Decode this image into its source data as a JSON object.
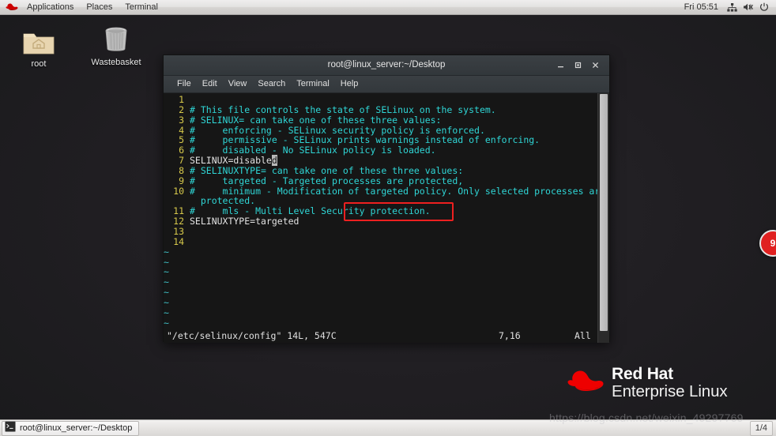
{
  "top_panel": {
    "logo_icon": "redhat-fedora-icon",
    "menus": [
      {
        "label": "Applications",
        "name": "applications-menu"
      },
      {
        "label": "Places",
        "name": "places-menu"
      },
      {
        "label": "Terminal",
        "name": "terminal-menu"
      }
    ],
    "clock": "Fri 05:51",
    "tray": [
      {
        "icon": "network-icon",
        "name": "network-tray-icon"
      },
      {
        "icon": "volume-muted-icon",
        "name": "volume-tray-icon"
      },
      {
        "icon": "power-icon",
        "name": "power-tray-icon"
      }
    ]
  },
  "desktop": {
    "icons": [
      {
        "label": "root",
        "icon": "home-folder-icon"
      },
      {
        "label": "Wastebasket",
        "icon": "trash-can-icon"
      }
    ]
  },
  "terminal": {
    "title": "root@linux_server:~/Desktop",
    "menus": [
      "File",
      "Edit",
      "View",
      "Search",
      "Terminal",
      "Help"
    ],
    "window_buttons": {
      "minimize": "_",
      "maximize": "■",
      "close": "✕"
    },
    "editor": {
      "lines": [
        {
          "num": "1",
          "type": "blank",
          "text": ""
        },
        {
          "num": "2",
          "type": "comment",
          "text": "# This file controls the state of SELinux on the system."
        },
        {
          "num": "3",
          "type": "comment",
          "text": "# SELINUX= can take one of these three values:"
        },
        {
          "num": "4",
          "type": "comment",
          "text": "#     enforcing - SELinux security policy is enforced."
        },
        {
          "num": "5",
          "type": "comment",
          "text": "#     permissive - SELinux prints warnings instead of enforcing."
        },
        {
          "num": "6",
          "type": "comment",
          "text": "#     disabled - No SELinux policy is loaded."
        },
        {
          "num": "7",
          "type": "code",
          "text": "SELINUX=disabled",
          "cursor_at": 15,
          "highlighted": true
        },
        {
          "num": "8",
          "type": "comment",
          "text": "# SELINUXTYPE= can take one of these three values:"
        },
        {
          "num": "9",
          "type": "comment",
          "text": "#     targeted - Targeted processes are protected,"
        },
        {
          "num": "10",
          "type": "comment",
          "text": "#     minimum - Modification of targeted policy. Only selected processes are"
        },
        {
          "num": "",
          "type": "comment",
          "text": "  protected.",
          "wrapped": true
        },
        {
          "num": "11",
          "type": "comment",
          "text": "#     mls - Multi Level Security protection."
        },
        {
          "num": "12",
          "type": "code",
          "text": "SELINUXTYPE=targeted"
        },
        {
          "num": "13",
          "type": "blank",
          "text": ""
        },
        {
          "num": "14",
          "type": "blank",
          "text": ""
        }
      ],
      "empty_markers": [
        "~",
        "~",
        "~",
        "~",
        "~",
        "~",
        "~",
        "~"
      ],
      "status": {
        "file": "\"/etc/selinux/config\" 14L, 547C",
        "position": "7,16",
        "scroll": "All"
      }
    },
    "annotation_color": "#ee2020"
  },
  "branding": {
    "line1": "Red Hat",
    "line2": "Enterprise Linux",
    "logo_icon": "redhat-fedora-icon"
  },
  "edge_badge": {
    "label": "9",
    "color": "#e02020"
  },
  "watermark": "https://blog.csdn.net/weixin_49297769",
  "taskbar": {
    "window_button": {
      "label": "root@linux_server:~/Desktop",
      "icon": "terminal-icon"
    },
    "workspace": "1/4"
  }
}
